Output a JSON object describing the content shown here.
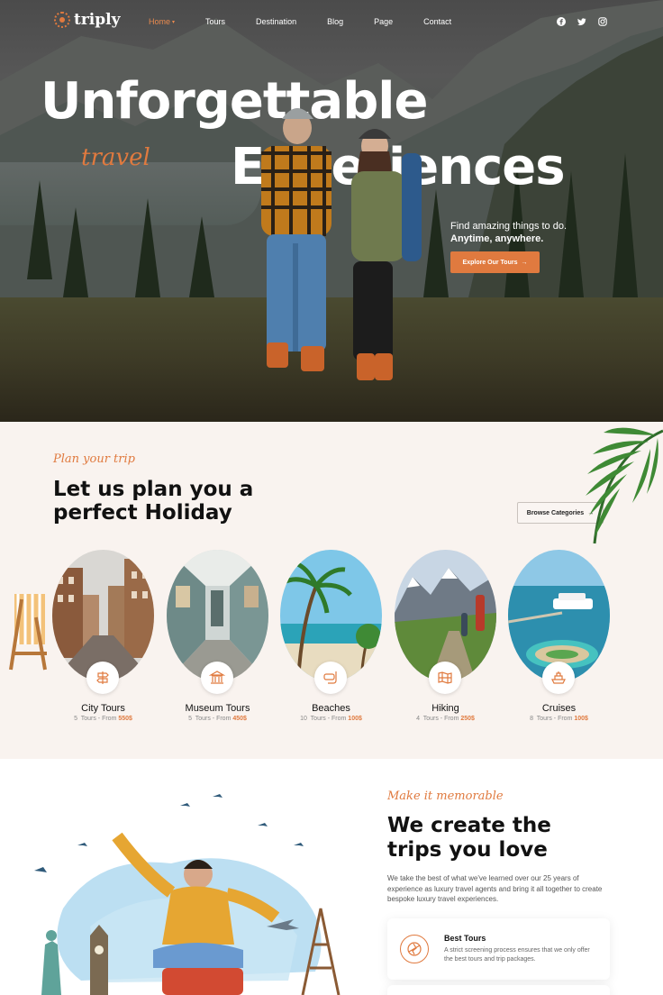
{
  "brand": {
    "name": "triply",
    "accent": "#e07a3f"
  },
  "nav": {
    "items": [
      {
        "label": "Home",
        "active": true,
        "dropdown": true
      },
      {
        "label": "Tours",
        "active": false,
        "dropdown": false
      },
      {
        "label": "Destination",
        "active": false,
        "dropdown": false
      },
      {
        "label": "Blog",
        "active": false,
        "dropdown": false
      },
      {
        "label": "Page",
        "active": false,
        "dropdown": false
      },
      {
        "label": "Contact",
        "active": false,
        "dropdown": false
      }
    ],
    "social": [
      "facebook-icon",
      "twitter-icon",
      "instagram-icon"
    ]
  },
  "hero": {
    "title_line1": "Unforgettable",
    "title_line2": "Experiences",
    "script": "travel",
    "sub1": "Find amazing things to do.",
    "sub2": "Anytime, anywhere.",
    "cta": "Explore Our Tours",
    "cta_arrow": "→"
  },
  "plan": {
    "script": "Plan your trip",
    "title_line1": "Let us plan you a",
    "title_line2": "perfect Holiday",
    "browse": "Browse Categories",
    "browse_arrow": "→"
  },
  "categories": [
    {
      "title": "City Tours",
      "count": "5",
      "tours": "Tours - From",
      "price": "550$",
      "icon": "signpost-icon"
    },
    {
      "title": "Museum Tours",
      "count": "5",
      "tours": "Tours - From",
      "price": "450$",
      "icon": "museum-icon"
    },
    {
      "title": "Beaches",
      "count": "10",
      "tours": "Tours - From",
      "price": "100$",
      "icon": "snorkel-icon"
    },
    {
      "title": "Hiking",
      "count": "4",
      "tours": "Tours - From",
      "price": "250$",
      "icon": "map-icon"
    },
    {
      "title": "Cruises",
      "count": "8",
      "tours": "Tours - From",
      "price": "100$",
      "icon": "ship-icon"
    }
  ],
  "memorable": {
    "script": "Make it memorable",
    "title_line1": "We create the",
    "title_line2": "trips you love",
    "paragraph": "We take the best of what we've learned over our 25 years of experience as luxury travel agents and bring it all together to create bespoke luxury travel experiences.",
    "features": [
      {
        "title": "Best Tours",
        "desc": "A strict screening process ensures that we only offer the best tours and trip packages.",
        "icon": "plane-globe-icon"
      }
    ]
  }
}
